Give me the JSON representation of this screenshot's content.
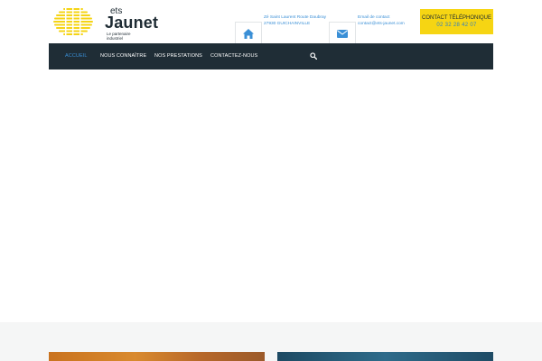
{
  "header": {
    "logo": {
      "top_text": "ets",
      "name": "Jaunet",
      "tagline": "Le partenaire industriel"
    },
    "address": {
      "line1": "Zé Saint Laurent Route Daubray",
      "line2": "27930 GUICHAINVILLE",
      "icon": "home-icon"
    },
    "email": {
      "line1": "Email de contact",
      "line2": "contact@ets-jaunet.com",
      "icon": "envelope-icon"
    },
    "contact_button": {
      "label": "CONTACT TÉLÉPHONIQUE",
      "phone": "02 32 28 42 07"
    }
  },
  "nav": {
    "items": [
      {
        "label": "ACCUEIL",
        "active": true
      },
      {
        "label": "NOUS CONNAÎTRE",
        "active": false
      },
      {
        "label": "NOS PRESTATIONS",
        "active": false
      },
      {
        "label": "CONTACTEZ-NOUS",
        "active": false
      }
    ],
    "search_icon": "search-icon"
  },
  "colors": {
    "nav_bg": "#1f2d36",
    "accent_blue": "#3a8fd6",
    "accent_yellow": "#f6d513",
    "logo_yellow": "#f5d416",
    "band_bg": "#f5f6f6"
  }
}
